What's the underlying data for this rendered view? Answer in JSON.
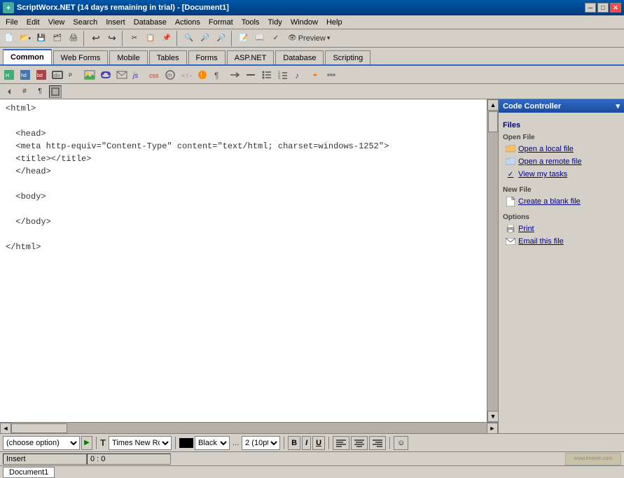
{
  "titlebar": {
    "title": "ScriptWorx.NET  (14 days remaining in trial)  - [Document1]",
    "icon_label": "SW",
    "minimize": "─",
    "restore": "□",
    "close": "✕"
  },
  "menubar": {
    "items": [
      {
        "label": "File"
      },
      {
        "label": "Edit"
      },
      {
        "label": "View"
      },
      {
        "label": "Search"
      },
      {
        "label": "Insert"
      },
      {
        "label": "Database"
      },
      {
        "label": "Actions"
      },
      {
        "label": "Format"
      },
      {
        "label": "Tools"
      },
      {
        "label": "Tidy"
      },
      {
        "label": "Window"
      },
      {
        "label": "Help"
      }
    ]
  },
  "tabs": {
    "items": [
      {
        "label": "Common",
        "active": true
      },
      {
        "label": "Web Forms"
      },
      {
        "label": "Mobile"
      },
      {
        "label": "Tables"
      },
      {
        "label": "Forms"
      },
      {
        "label": "ASP.NET"
      },
      {
        "label": "Database"
      },
      {
        "label": "Scripting"
      }
    ]
  },
  "subtoolbar": {
    "hash": "#",
    "pilcrow": "¶",
    "box": "□"
  },
  "editor": {
    "content": "<html>\n\n  <head>\n  <meta http-equiv=\"Content-Type\" content=\"text/html; charset=windows-1252\">\n  <title></title>\n  </head>\n\n  <body>\n\n  </body>\n\n</html>"
  },
  "right_panel": {
    "header": "Code Controller",
    "files_section": "Files",
    "open_file_label": "Open File",
    "open_local": "Open a local file",
    "open_remote": "Open a remote file",
    "view_tasks": "View my tasks",
    "new_file_label": "New File",
    "create_blank": "Create a blank file",
    "options_label": "Options",
    "print": "Print",
    "email": "Email this file",
    "expand_icon": "▾"
  },
  "bottom_toolbar": {
    "choose_option": "(choose option)",
    "play_icon": "▶",
    "font_icon": "T",
    "font_name": "Times New Rom",
    "color_label": "Black",
    "dots": "...",
    "size": "2 (10pt",
    "bold": "B",
    "italic": "I",
    "underline": "U",
    "align_left": "≡",
    "align_center": "≡",
    "align_right": "≡",
    "smiley": "☺"
  },
  "statusbar": {
    "mode": "Insert",
    "position": "0 : 0"
  },
  "docbar": {
    "doc_name": "Document1"
  }
}
